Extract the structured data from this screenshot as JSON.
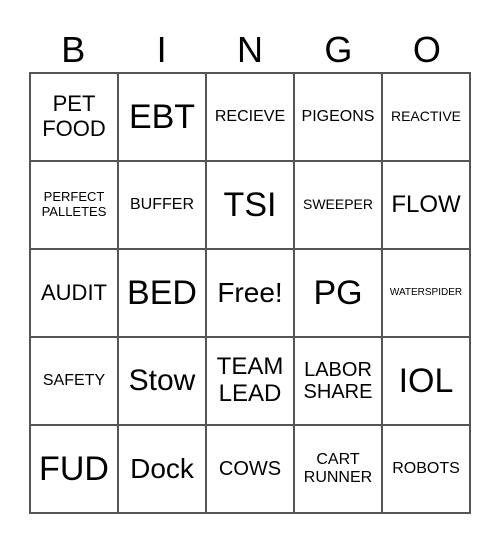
{
  "header": [
    "B",
    "I",
    "N",
    "G",
    "O"
  ],
  "cells": [
    [
      "PET\nFOOD",
      "EBT",
      "RECIEVE",
      "PIGEONS",
      "REACTIVE"
    ],
    [
      "PERFECT\nPALLETES",
      "BUFFER",
      "TSI",
      "SWEEPER",
      "FLOW"
    ],
    [
      "AUDIT",
      "BED",
      "Free!",
      "PG",
      "WATERSPIDER"
    ],
    [
      "SAFETY",
      "Stow",
      "TEAM\nLEAD",
      "LABOR\nSHARE",
      "IOL"
    ],
    [
      "FUD",
      "Dock",
      "COWS",
      "CART\nRUNNER",
      "ROBOTS"
    ]
  ]
}
